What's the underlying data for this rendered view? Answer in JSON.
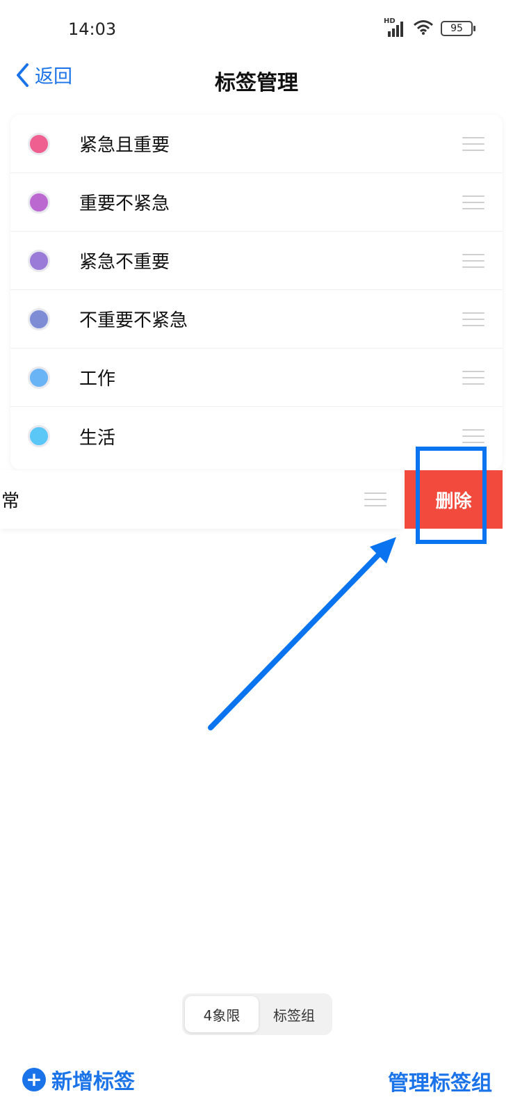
{
  "status_bar": {
    "time": "14:03",
    "network_label": "HD",
    "battery": "95"
  },
  "nav": {
    "back_label": "返回",
    "title": "标签管理"
  },
  "tags": [
    {
      "label": "紧急且重要",
      "color": "#ef5f8f"
    },
    {
      "label": "重要不紧急",
      "color": "#bb69d1"
    },
    {
      "label": "紧急不重要",
      "color": "#9b7bd8"
    },
    {
      "label": "不重要不紧急",
      "color": "#7e8cd6"
    },
    {
      "label": "工作",
      "color": "#68b4f5"
    },
    {
      "label": "生活",
      "color": "#5bc7f6"
    }
  ],
  "swiped_row": {
    "label": "常",
    "delete_label": "删除",
    "delete_color": "#f24a3c"
  },
  "segmented": {
    "active": "4象限",
    "inactive": "标签组"
  },
  "bottom": {
    "add_tag_label": "新增标签",
    "manage_label": "管理标签组"
  },
  "accent_color": "#1a73e8",
  "annotation_color": "#0a73f0"
}
